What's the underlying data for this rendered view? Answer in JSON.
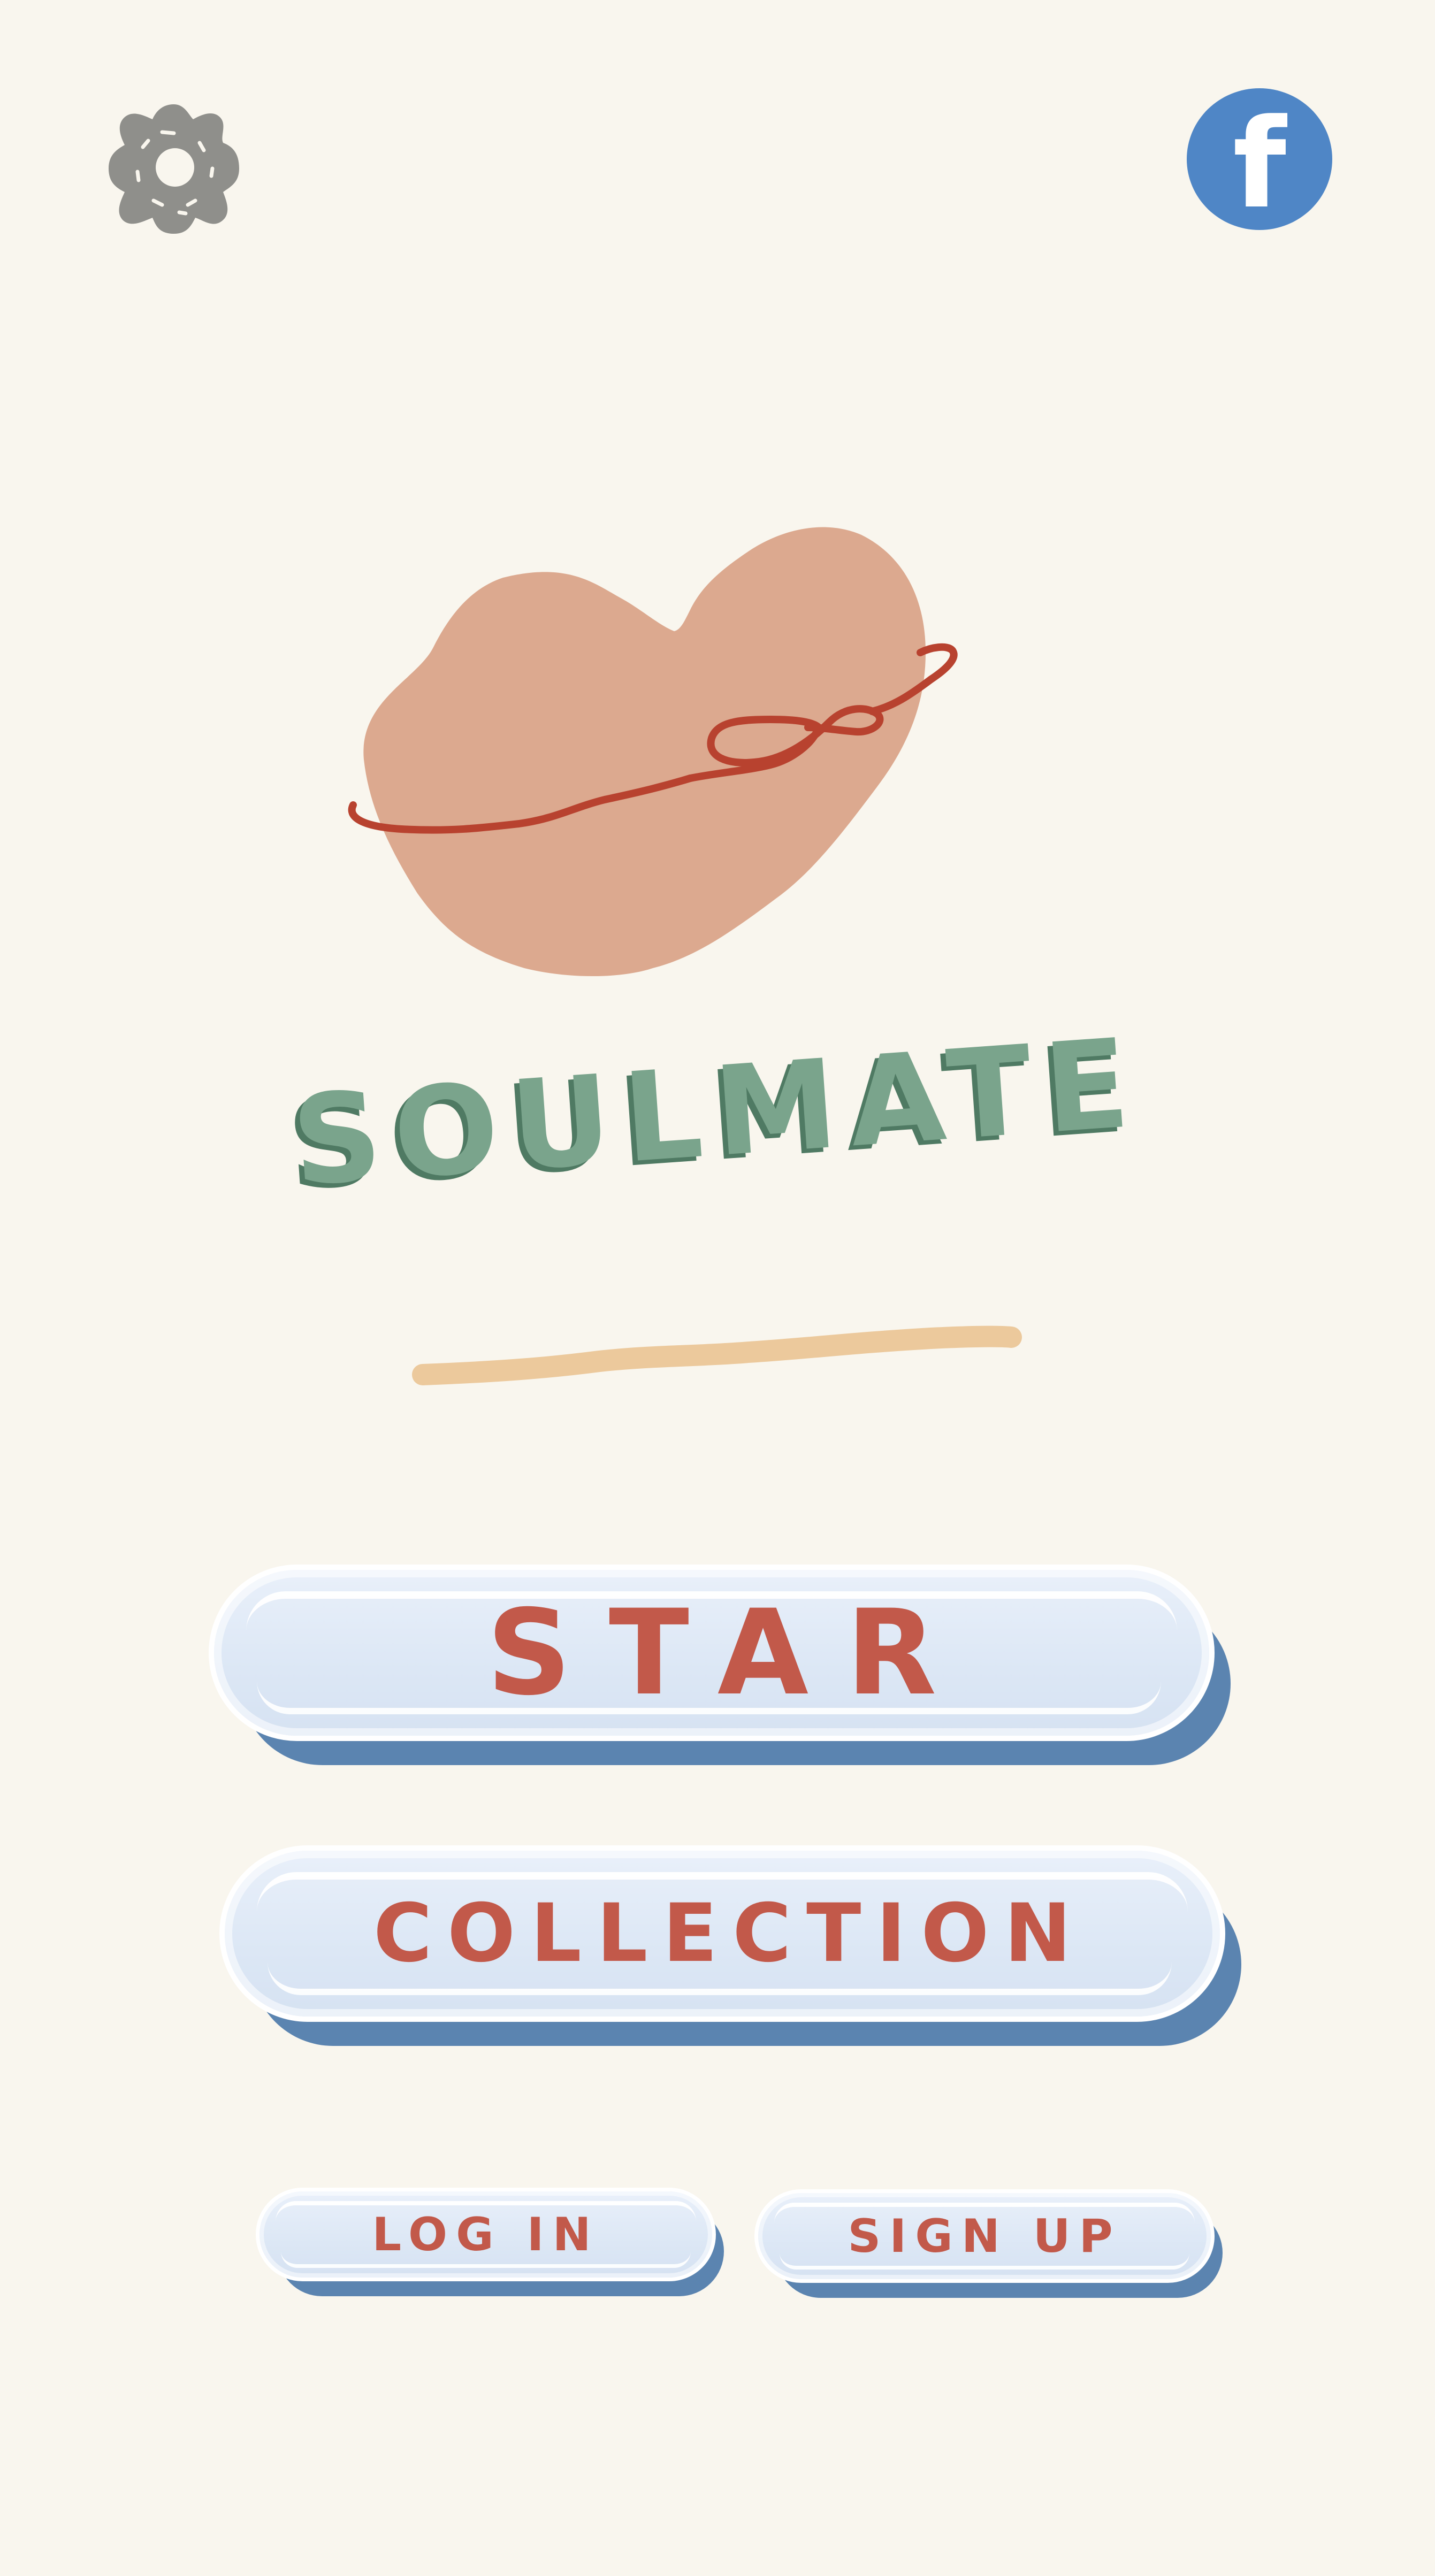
{
  "header": {
    "settings_icon": "gear-icon",
    "facebook_icon": "facebook-icon",
    "facebook_glyph": "f"
  },
  "logo": {
    "icon": "heart-with-red-string-icon",
    "title": "SOULMATE"
  },
  "menu": {
    "start_label": "STAR",
    "collection_label": "COLLECTION"
  },
  "account": {
    "login_label": "LOG IN",
    "signup_label": "SIGN UP"
  },
  "colors": {
    "background": "#f9f6ee",
    "heart": "#dca98f",
    "string": "#b8422f",
    "title": "#7aa48c",
    "title_shadow": "#4f7a63",
    "underline": "#ecc99c",
    "button_face": "#dfe8f5",
    "button_shadow": "#5b84b0",
    "button_text": "#c2594a",
    "facebook": "#4f86c6",
    "gear": "#8f8f8b"
  }
}
